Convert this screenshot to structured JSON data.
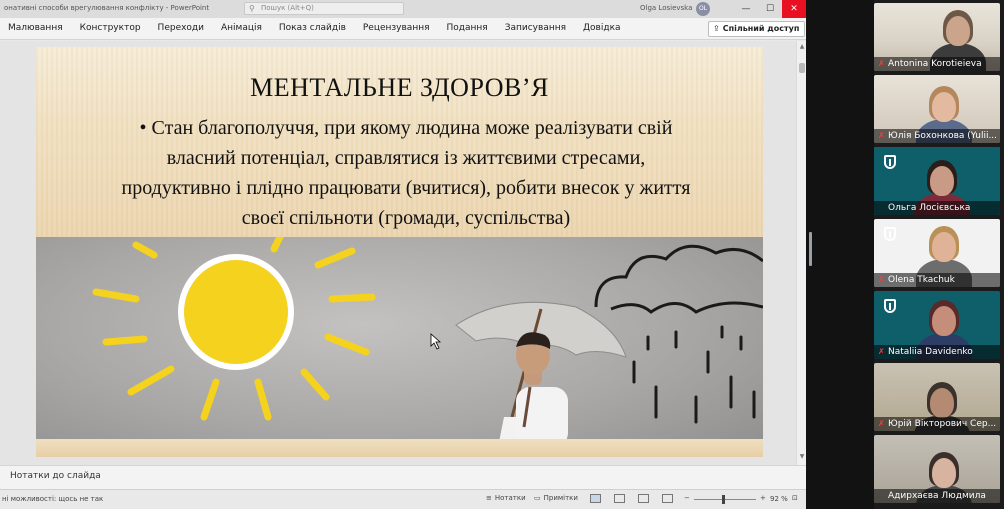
{
  "window": {
    "doc_title": "онативні способи врегулювання конфлікту  -  PowerPoint",
    "search_placeholder": "Пошук (Alt+Q)",
    "user_name": "Olga Losievska",
    "user_initials": "OL",
    "minimize": "—",
    "maximize": "☐",
    "close": "✕"
  },
  "ribbon": {
    "tabs": [
      "Малювання",
      "Конструктор",
      "Переходи",
      "Анімація",
      "Показ слайдів",
      "Рецензування",
      "Подання",
      "Записування",
      "Довідка"
    ],
    "share_label": "Спільний доступ"
  },
  "slide": {
    "title": "МЕНТАЛЬНЕ ЗДОРОВ’Я",
    "body": "• Стан благополуччя, при якому людина може реалізувати свій власний потенціал, справлятися із життєвими стресами, продуктивно і плідно працювати (вчитися), робити внесок у життя своєї спільноти (громади, суспільства)"
  },
  "notes": {
    "label": "Нотатки до слайда"
  },
  "status": {
    "accessibility": "ні можливості: щось не так",
    "notes_btn": "Нотатки",
    "comments_btn": "Примітки",
    "zoom": "92 %",
    "zoom_fraction": 0.46
  },
  "gallery": {
    "participants": [
      {
        "name": "Antonina Korotieieva",
        "muted": true,
        "speaking": false
      },
      {
        "name": "Юлія Бохонкова (Yulii...",
        "muted": true,
        "speaking": false
      },
      {
        "name": "Ольга Лосієвська",
        "muted": false,
        "speaking": true
      },
      {
        "name": "Olena Tkachuk",
        "muted": true,
        "speaking": false
      },
      {
        "name": "Nataliia Davidenko",
        "muted": true,
        "speaking": false
      },
      {
        "name": "Юрій Вікторович Сер...",
        "muted": true,
        "speaking": false
      },
      {
        "name": "Адирхаєва Людмила",
        "muted": false,
        "speaking": false
      }
    ]
  },
  "colors": {
    "close_red": "#e81123",
    "speaking_green": "#3fd14b",
    "sun_yellow": "#f4d21e"
  }
}
